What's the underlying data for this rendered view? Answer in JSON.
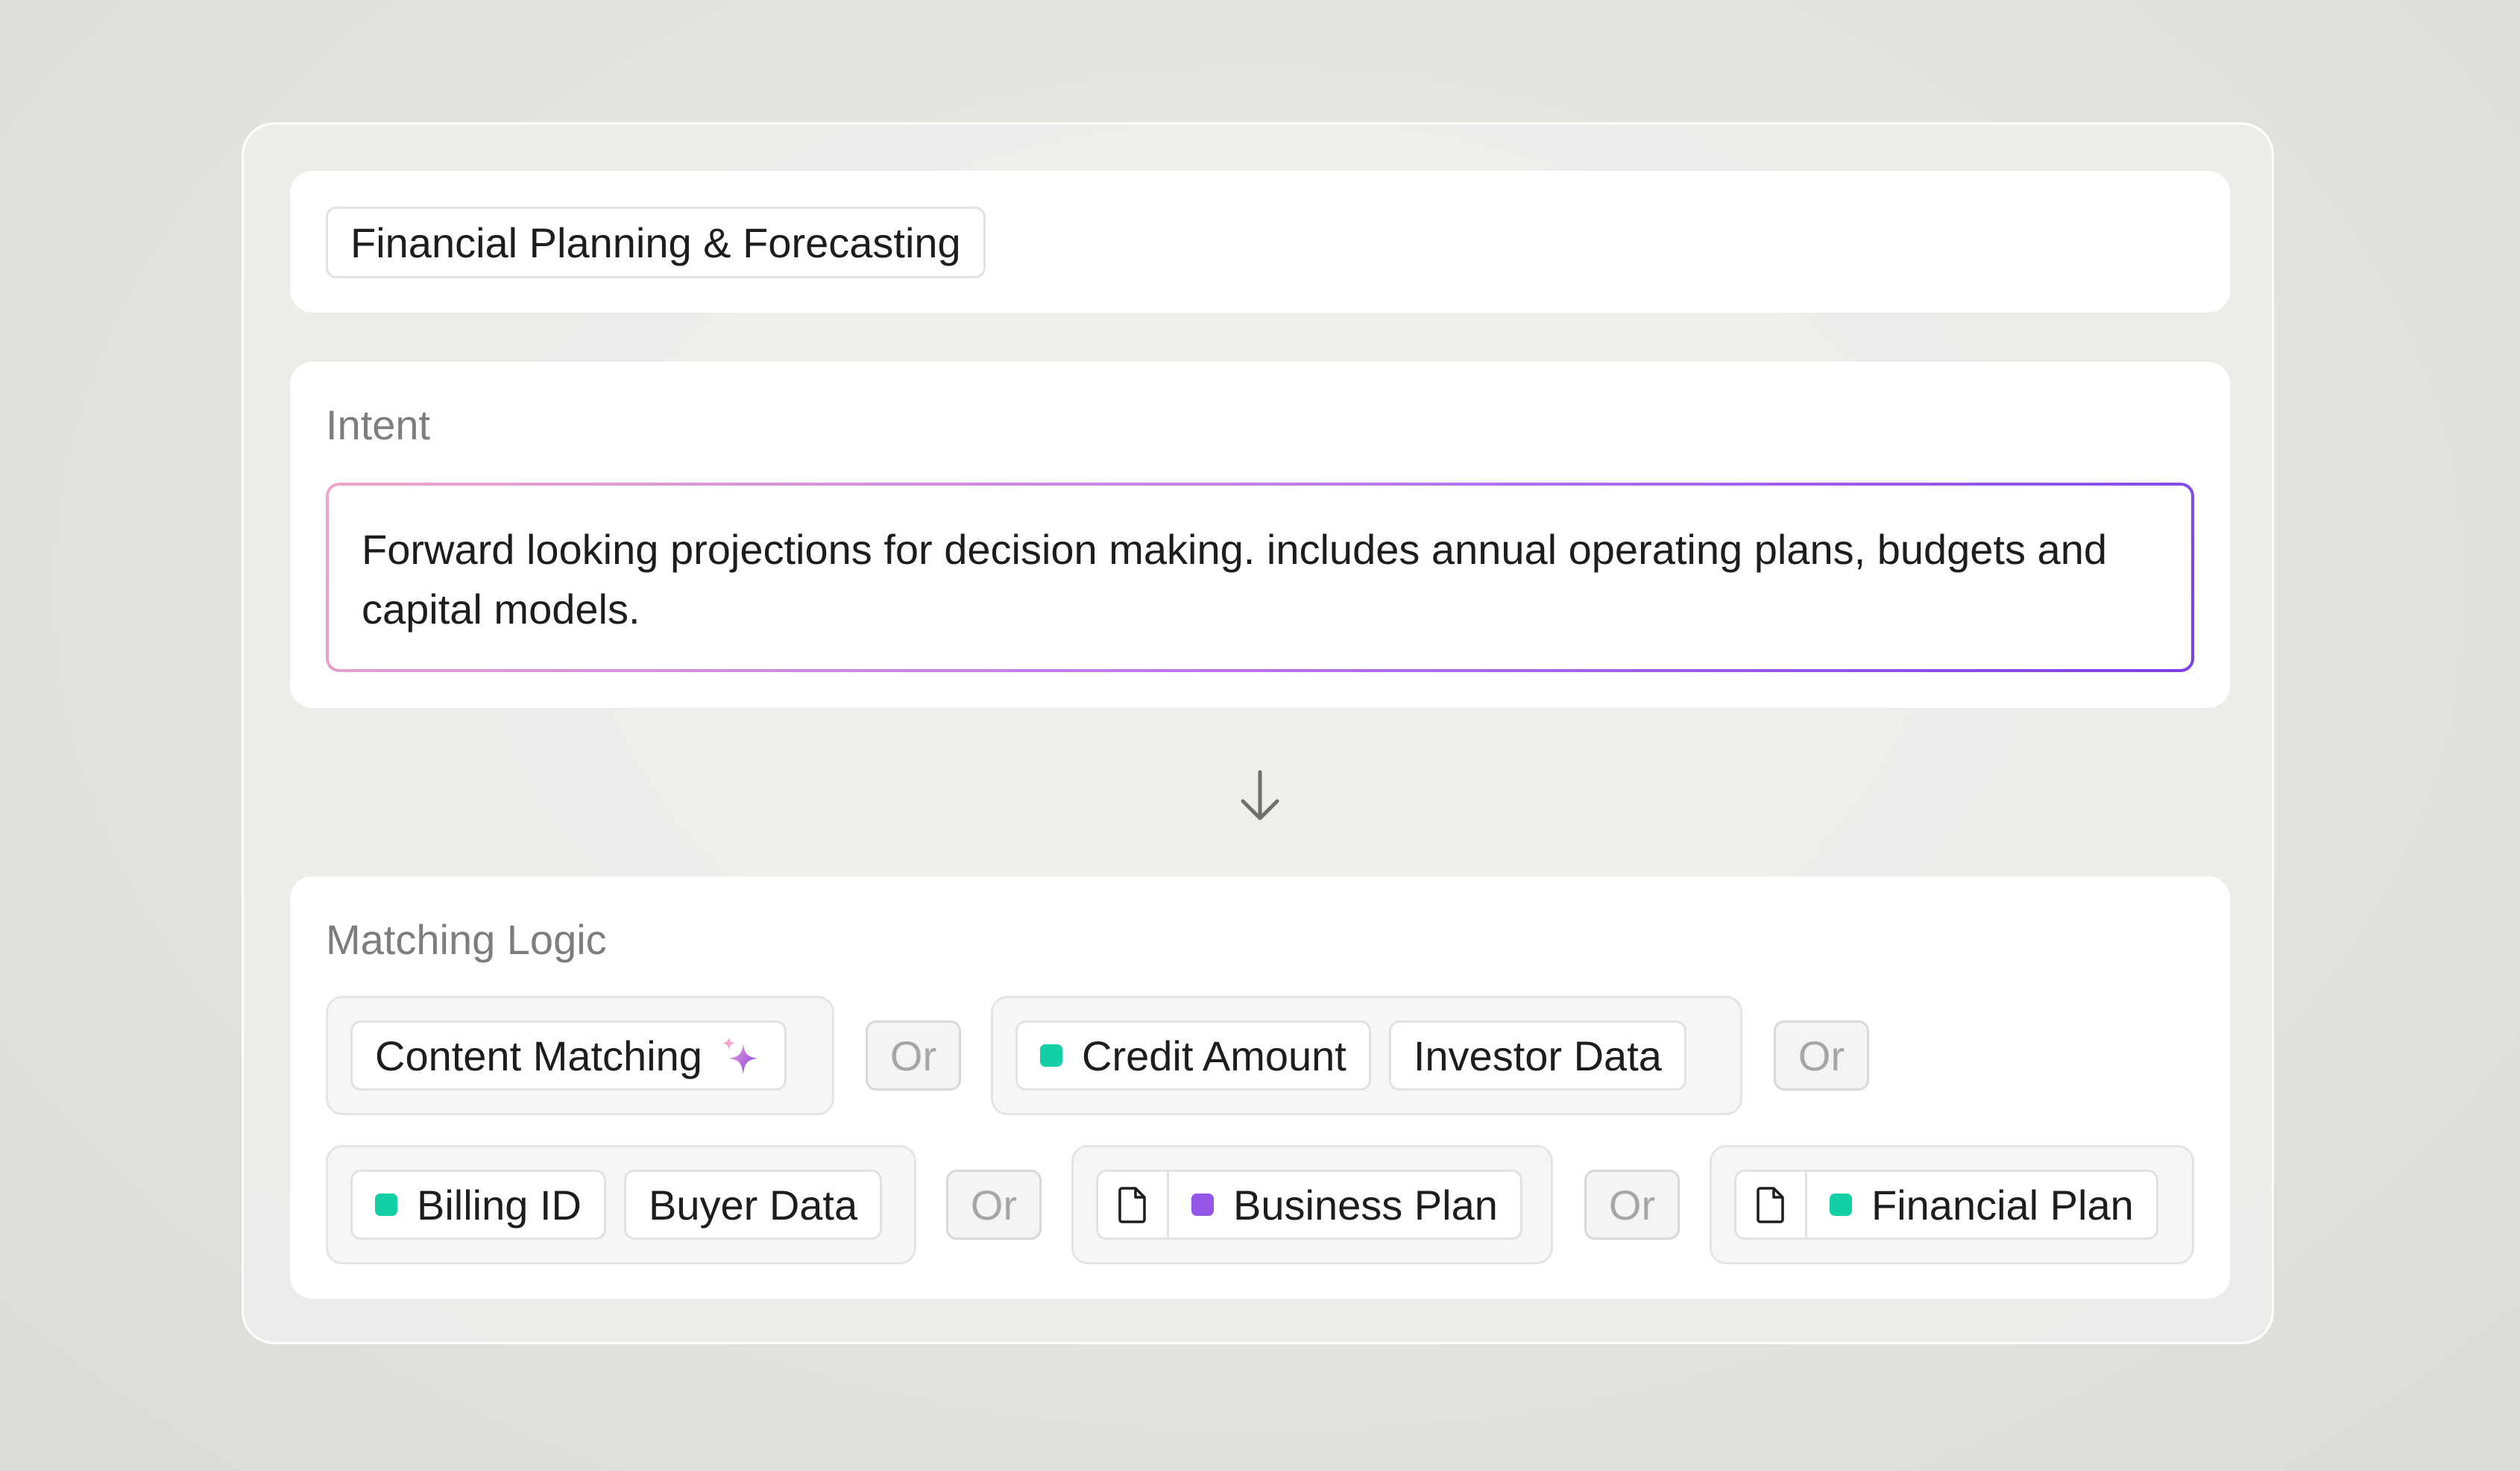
{
  "header": {
    "title_chip": "Financial Planning & Forecasting"
  },
  "intent": {
    "label": "Intent",
    "text": "Forward looking projections for decision making. includes annual operating plans, budgets and capital models."
  },
  "matching_logic": {
    "label": "Matching Logic",
    "or_label": "Or",
    "groups": [
      {
        "chips": [
          {
            "label": "Content Matching",
            "icon": "sparkle-icon"
          }
        ]
      },
      {
        "chips": [
          {
            "label": "Credit Amount",
            "dot_color": "#12cfa6"
          },
          {
            "label": "Investor Data"
          }
        ]
      },
      {
        "chips": [
          {
            "label": "Billing ID",
            "dot_color": "#12cfa6"
          },
          {
            "label": "Buyer Data"
          }
        ]
      },
      {
        "chips": [
          {
            "label": "Business Plan",
            "dot_color": "#9556e8",
            "icon": "document-icon"
          }
        ]
      },
      {
        "chips": [
          {
            "label": "Financial Plan",
            "dot_color": "#12cfa6",
            "icon": "document-icon"
          }
        ]
      }
    ]
  },
  "colors": {
    "teal": "#12cfa6",
    "purple": "#9556e8",
    "intent_gradient_start": "#f0a6c8",
    "intent_gradient_end": "#7b3fe4"
  }
}
